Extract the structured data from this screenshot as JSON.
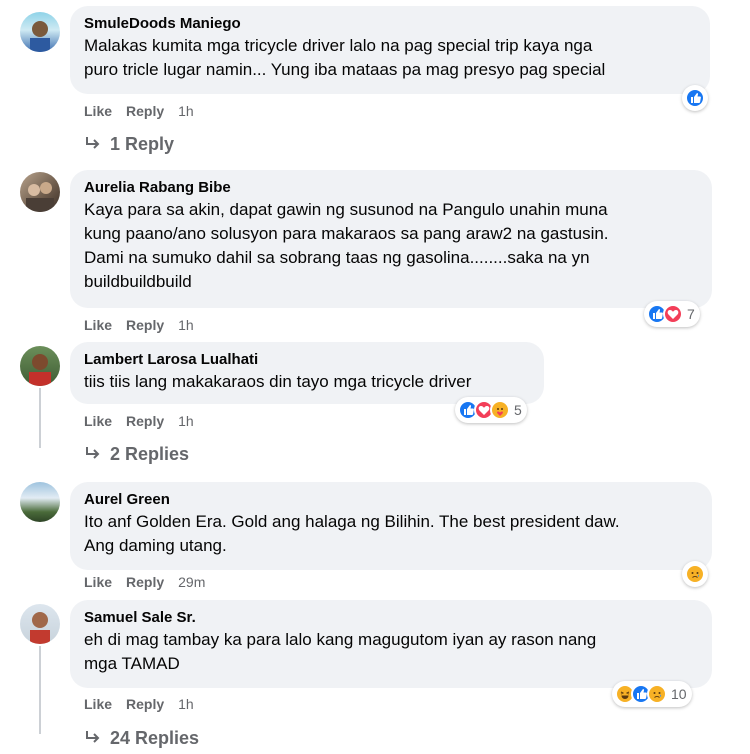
{
  "comments": [
    {
      "author": "SmuleDoods Maniego",
      "text_lines": [
        "Malakas kumita mga tricycle driver lalo na pag special trip kaya nga",
        "puro tricle lugar namin... Yung iba mataas pa mag presyo pag special"
      ],
      "like": "Like",
      "reply": "Reply",
      "time": "1h",
      "reactions": [
        "like"
      ],
      "reaction_count": "",
      "replies_link": "1 Reply"
    },
    {
      "author": "Aurelia Rabang Bibe",
      "text_lines": [
        "Kaya para sa akin, dapat gawin ng susunod na Pangulo unahin muna",
        "kung paano/ano solusyon para makaraos sa pang araw2 na gastusin.",
        "Dami na sumuko dahil sa sobrang taas ng gasolina........saka na yn",
        "buildbuildbuild"
      ],
      "like": "Like",
      "reply": "Reply",
      "time": "1h",
      "reactions": [
        "like",
        "love"
      ],
      "reaction_count": "7",
      "replies_link": ""
    },
    {
      "author": "Lambert Larosa Lualhati",
      "text_lines": [
        "tiis tiis lang makakaraos din tayo mga tricycle driver"
      ],
      "like": "Like",
      "reply": "Reply",
      "time": "1h",
      "reactions": [
        "like",
        "love",
        "care"
      ],
      "reaction_count": "5",
      "replies_link": "2 Replies"
    },
    {
      "author": "Aurel Green",
      "text_lines": [
        "Ito anf Golden Era. Gold ang halaga ng Bilihin. The best president daw.",
        "Ang daming utang."
      ],
      "like": "Like",
      "reply": "Reply",
      "time": "29m",
      "reactions": [
        "sad"
      ],
      "reaction_count": "",
      "replies_link": ""
    },
    {
      "author": "Samuel Sale Sr.",
      "text_lines": [
        "eh di mag tambay ka para lalo kang magugutom iyan ay rason nang",
        "mga TAMAD"
      ],
      "like": "Like",
      "reply": "Reply",
      "time": "1h",
      "reactions": [
        "haha",
        "like",
        "sad"
      ],
      "reaction_count": "10",
      "replies_link": "24 Replies"
    }
  ],
  "colors": {
    "bubble": "#f0f2f5",
    "meta": "#65676b",
    "like_blue": "#1877f2",
    "love_red": "#f33e58",
    "emoji_yellow": "#f7b125"
  },
  "icons": {
    "reply_arrow": "reply-arrow-icon",
    "like": "like-reaction-icon",
    "love": "love-reaction-icon",
    "care": "care-reaction-icon",
    "sad": "sad-reaction-icon",
    "haha": "haha-reaction-icon"
  }
}
